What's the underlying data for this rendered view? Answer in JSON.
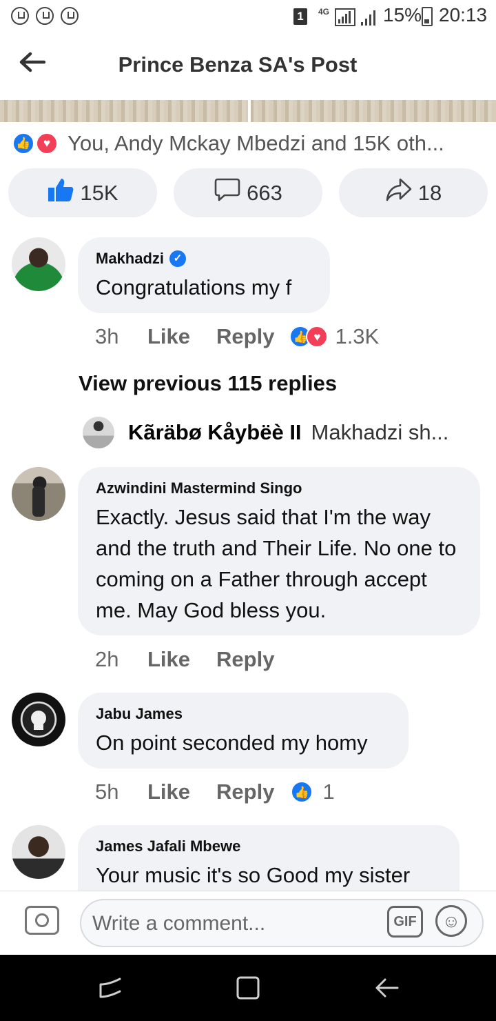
{
  "status_bar": {
    "sim": "1",
    "network": "4G",
    "battery": "15%",
    "time": "20:13"
  },
  "header": {
    "title": "Prince Benza SA's Post"
  },
  "reactions_summary": "You, Andy Mckay Mbedzi and 15K oth...",
  "actions": {
    "like_count": "15K",
    "comment_count": "663",
    "share_count": "18"
  },
  "comments": [
    {
      "name": "Makhadzi",
      "verified": true,
      "text": "Congratulations my f",
      "time": "3h",
      "like_label": "Like",
      "reply_label": "Reply",
      "reaction_count": "1.3K"
    },
    {
      "name": "Azwindini Mastermind Singo",
      "text": "Exactly. Jesus said that I'm the way and the truth and Their Life. No one to coming on a Father through accept me. May God bless you.",
      "time": "2h",
      "like_label": "Like",
      "reply_label": "Reply"
    },
    {
      "name": "Jabu James",
      "text": "On point seconded my homy",
      "time": "5h",
      "like_label": "Like",
      "reply_label": "Reply",
      "reaction_count": "1"
    },
    {
      "name": "James Jafali Mbewe",
      "text": "Your music it's so Good my sister"
    }
  ],
  "view_previous": "View previous 115 replies",
  "reply_preview": {
    "name": "Kãräbø Kåybëè II",
    "text": "Makhadzi sh..."
  },
  "composer": {
    "placeholder": "Write a comment...",
    "gif_label": "GIF"
  },
  "colors": {
    "accent": "#1877f2",
    "love": "#f33e58",
    "bubble": "#f0f2f5"
  }
}
